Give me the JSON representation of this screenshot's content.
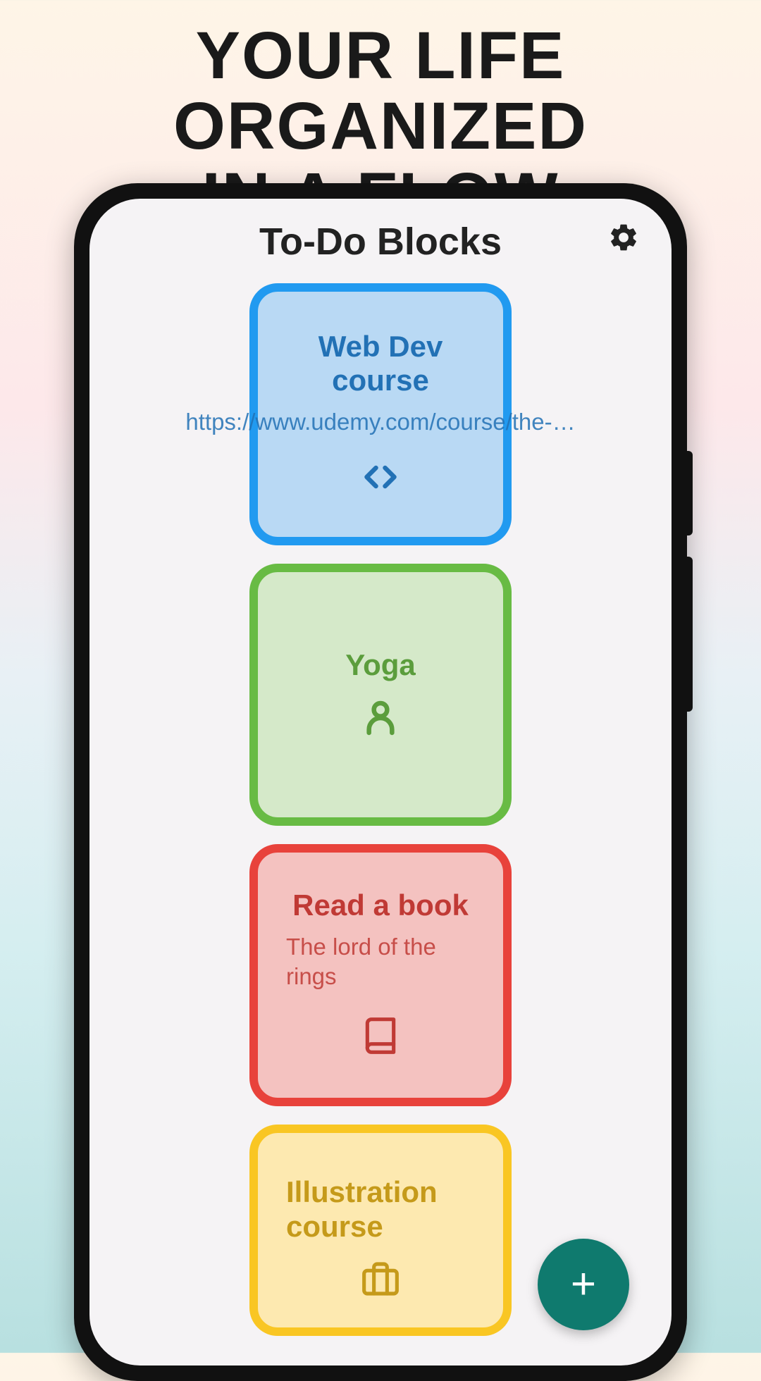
{
  "promo": {
    "headline_line1": "YOUR LiFE ORGANiZED",
    "headline_line2": "iN A FLOW"
  },
  "app": {
    "title": "To-Do Blocks"
  },
  "blocks": [
    {
      "title": "Web Dev course",
      "subtitle": "https://www.udemy.com/course/the-…",
      "icon": "code-icon",
      "color": "blue"
    },
    {
      "title": "Yoga",
      "subtitle": "",
      "icon": "person-icon",
      "color": "green"
    },
    {
      "title": "Read a book",
      "subtitle": "The lord of the rings",
      "icon": "book-icon",
      "color": "red"
    },
    {
      "title": "Illustration course",
      "subtitle": "",
      "icon": "briefcase-icon",
      "color": "yellow"
    }
  ],
  "fab": {
    "label": "+"
  }
}
